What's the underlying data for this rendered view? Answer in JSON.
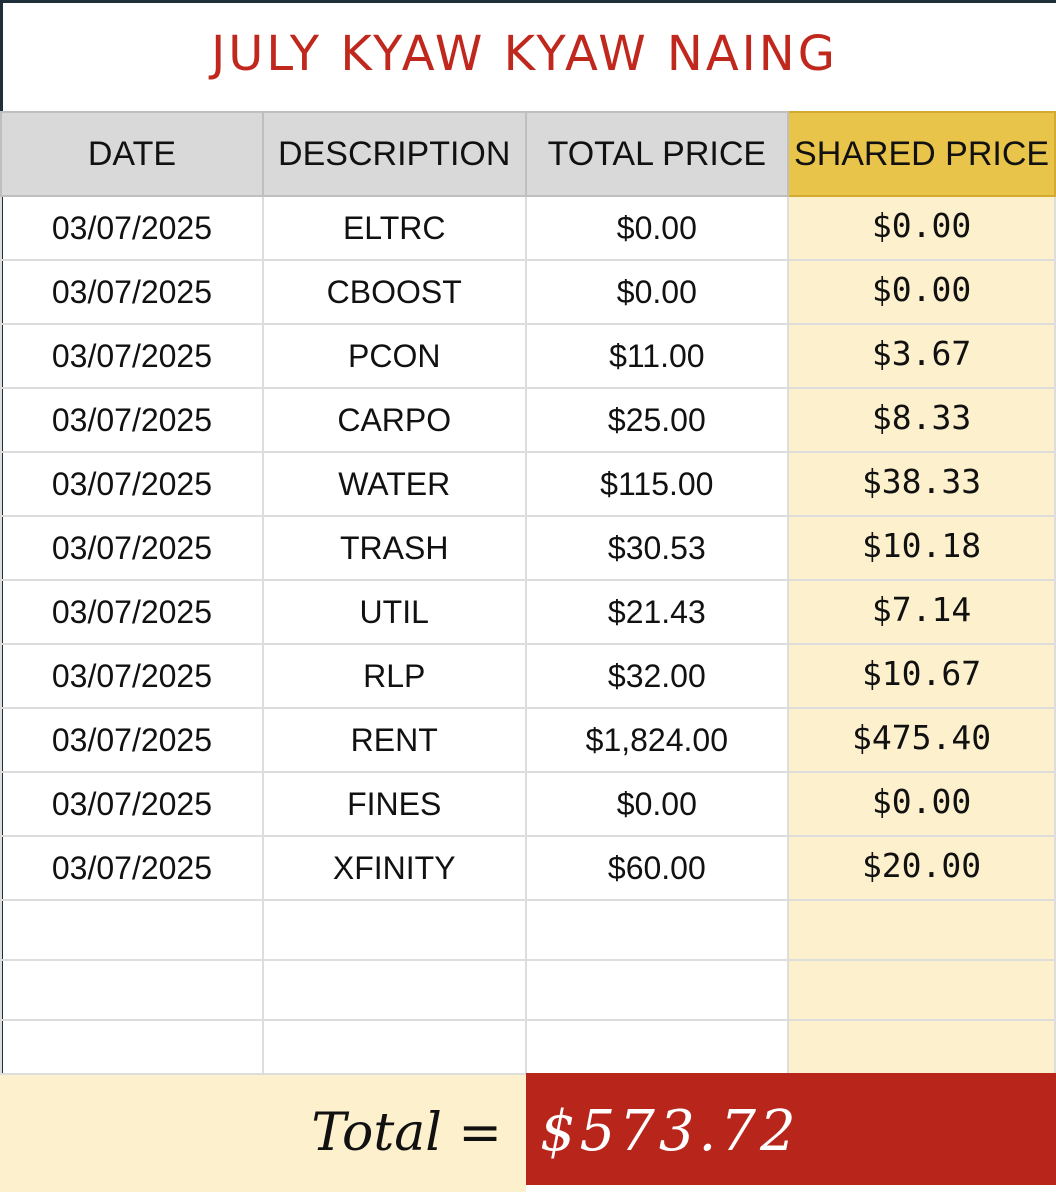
{
  "sheet": {
    "title": "JULY KYAW KYAW NAING",
    "headers": {
      "date": "DATE",
      "description": "DESCRIPTION",
      "total_price": "TOTAL PRICE",
      "shared_price": "SHARED PRICE"
    },
    "rows": [
      {
        "date": "03/07/2025",
        "description": "ELTRC",
        "total_price": "$0.00",
        "shared_price": "$0.00"
      },
      {
        "date": "03/07/2025",
        "description": "CBOOST",
        "total_price": "$0.00",
        "shared_price": "$0.00"
      },
      {
        "date": "03/07/2025",
        "description": "PCON",
        "total_price": "$11.00",
        "shared_price": "$3.67"
      },
      {
        "date": "03/07/2025",
        "description": "CARPO",
        "total_price": "$25.00",
        "shared_price": "$8.33"
      },
      {
        "date": "03/07/2025",
        "description": "WATER",
        "total_price": "$115.00",
        "shared_price": "$38.33"
      },
      {
        "date": "03/07/2025",
        "description": "TRASH",
        "total_price": "$30.53",
        "shared_price": "$10.18"
      },
      {
        "date": "03/07/2025",
        "description": "UTIL",
        "total_price": "$21.43",
        "shared_price": "$7.14"
      },
      {
        "date": "03/07/2025",
        "description": "RLP",
        "total_price": "$32.00",
        "shared_price": "$10.67"
      },
      {
        "date": "03/07/2025",
        "description": "RENT",
        "total_price": "$1,824.00",
        "shared_price": "$475.40"
      },
      {
        "date": "03/07/2025",
        "description": "FINES",
        "total_price": "$0.00",
        "shared_price": "$0.00"
      },
      {
        "date": "03/07/2025",
        "description": "XFINITY",
        "total_price": "$60.00",
        "shared_price": "$20.00"
      }
    ],
    "total_label": "Total =",
    "total_value": "$573.72"
  },
  "colors": {
    "title": "#c0271d",
    "header_bg": "#d9d9d9",
    "shared_header_bg": "#e9c44a",
    "shared_cell_bg": "#fcf0cd",
    "total_value_bg": "#b8261b"
  }
}
